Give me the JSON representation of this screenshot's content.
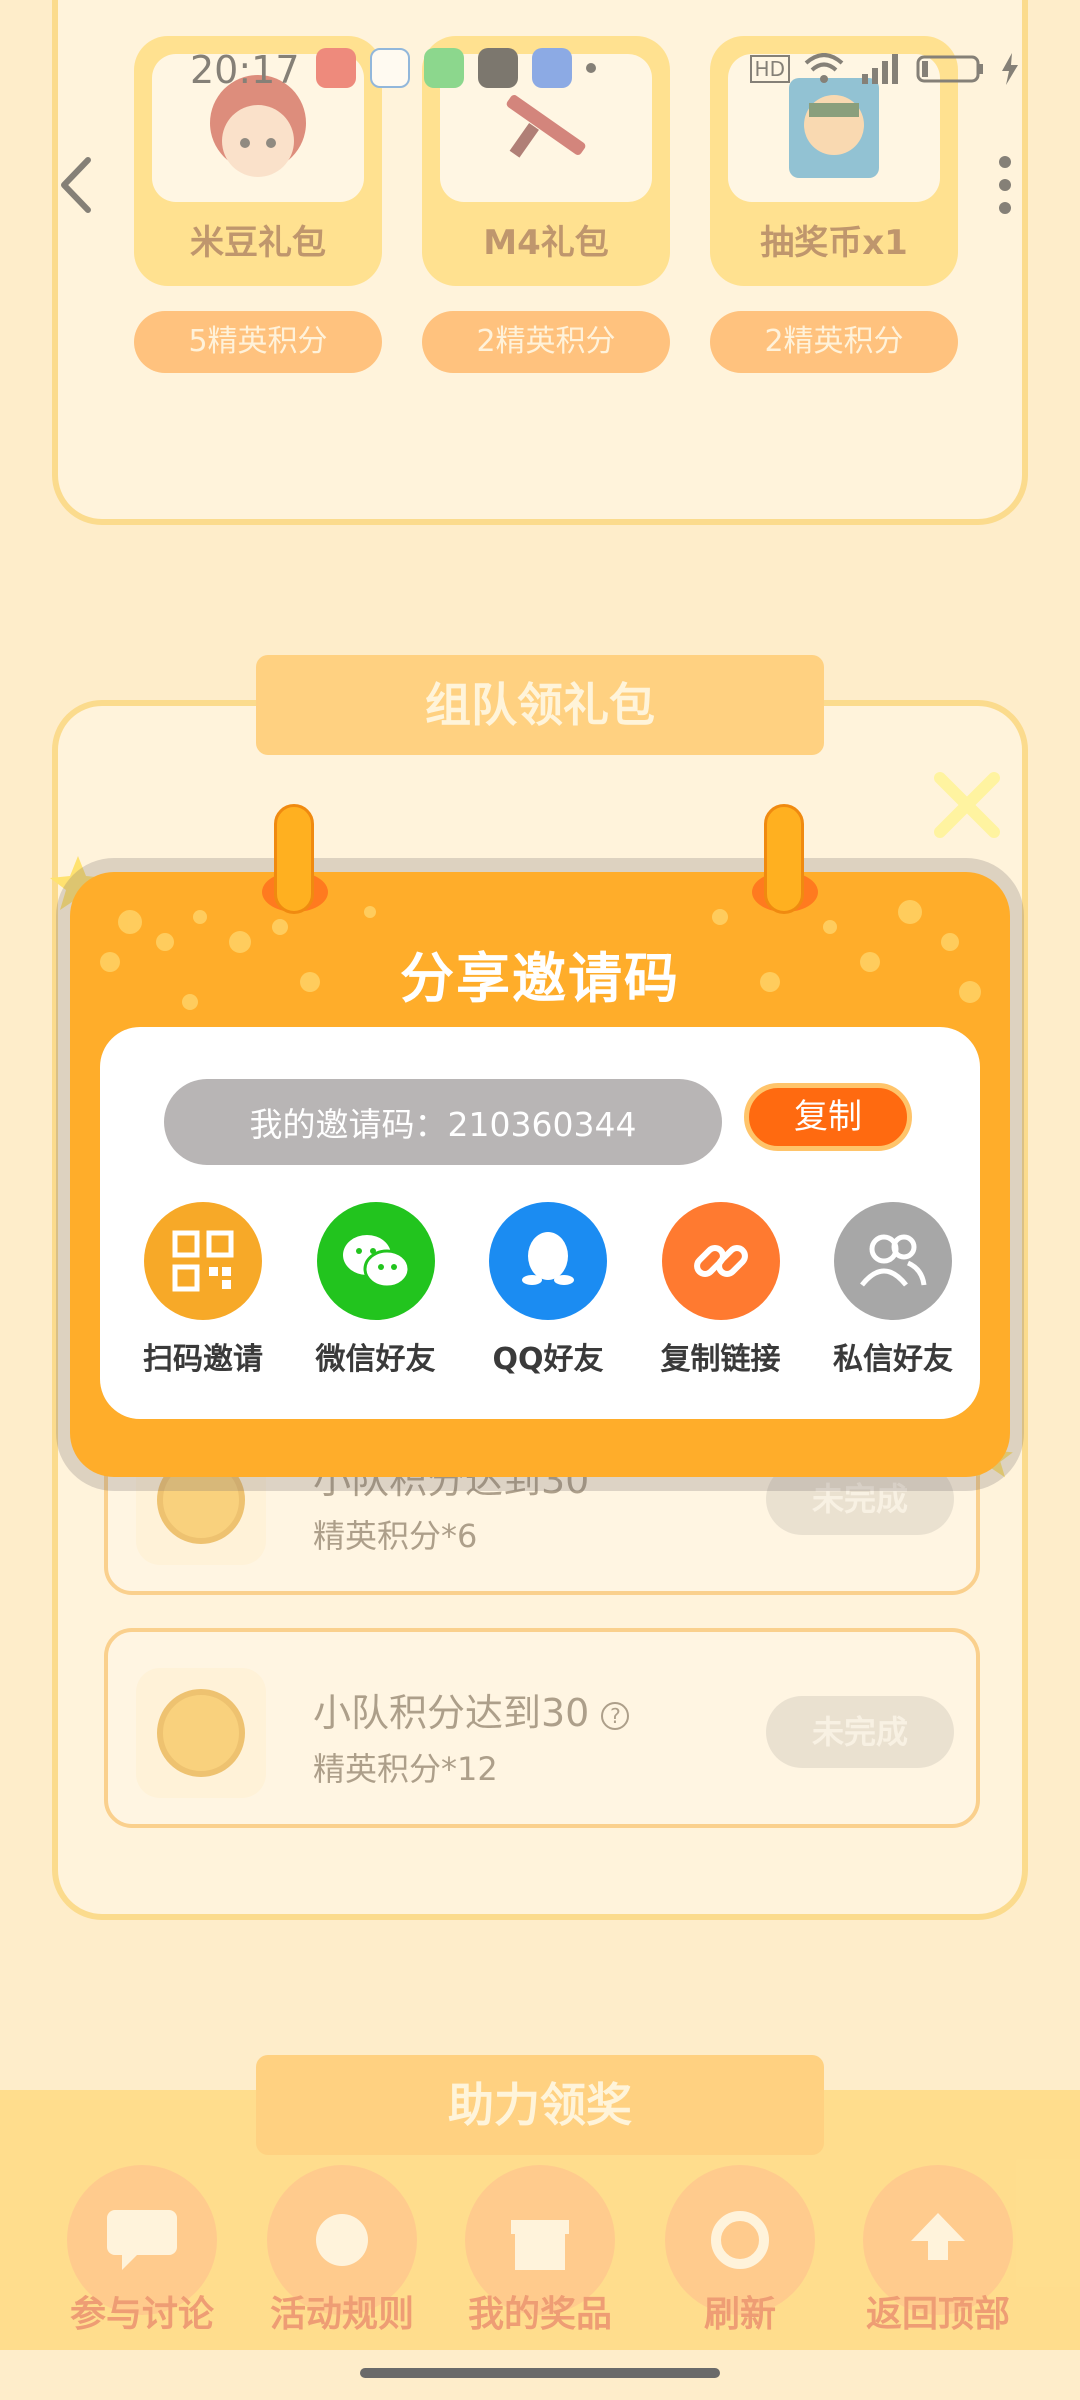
{
  "status_bar": {
    "time": "20:17",
    "battery": "battery-icon"
  },
  "gifts": [
    {
      "title": "米豆礼包",
      "cost": "5精英积分"
    },
    {
      "title": "M4礼包",
      "cost": "2精英积分"
    },
    {
      "title": "抽奖币x1",
      "cost": "2精英积分"
    }
  ],
  "team_section": {
    "title": "组队领礼包"
  },
  "tasks": [
    {
      "title": "小队积分达到30",
      "reward": "精英积分*6",
      "status": "未完成"
    },
    {
      "title": "小队积分达到30",
      "reward": "精英积分*12",
      "status": "未完成"
    }
  ],
  "assist_section": {
    "title": "助力领奖"
  },
  "bottom_nav": [
    {
      "label": "参与讨论"
    },
    {
      "label": "活动规则"
    },
    {
      "label": "我的奖品"
    },
    {
      "label": "刷新"
    },
    {
      "label": "返回顶部"
    }
  ],
  "modal": {
    "title": "分享邀请码",
    "invite_code_text": "我的邀请码：210360344",
    "copy_label": "复制",
    "share_options": [
      {
        "label": "扫码邀请",
        "icon": "qr-code-icon",
        "color": "#f7a928"
      },
      {
        "label": "微信好友",
        "icon": "wechat-icon",
        "color": "#22c41e"
      },
      {
        "label": "QQ好友",
        "icon": "qq-icon",
        "color": "#1b8cf2"
      },
      {
        "label": "复制链接",
        "icon": "link-icon",
        "color": "#ff7a30"
      },
      {
        "label": "私信好友",
        "icon": "friends-icon",
        "color": "#a7a7a7"
      }
    ]
  },
  "colors": {
    "modal_bg": "#ffad2a",
    "copy_button": "#ff6a10",
    "page_bg": "#fde7b9"
  }
}
